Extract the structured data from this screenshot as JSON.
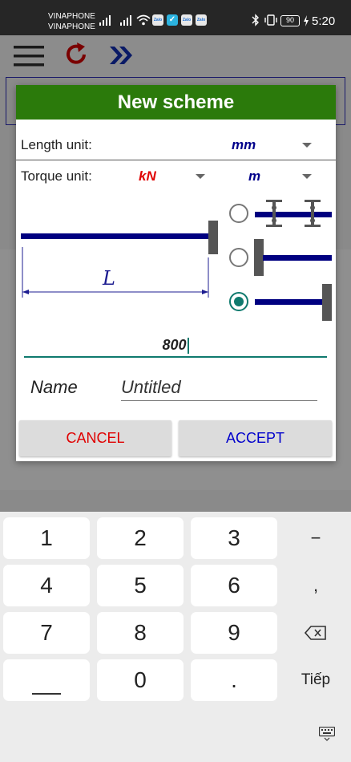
{
  "status_bar": {
    "carrier1": "VINAPHONE",
    "carrier2": "VINAPHONE",
    "battery": "90",
    "time": "5:20",
    "app_icon_label": "Zalo"
  },
  "dialog": {
    "title": "New scheme",
    "length_unit": {
      "label": "Length unit:",
      "value": "mm"
    },
    "torque_unit": {
      "label": "Torque unit:",
      "force": "kN",
      "length": "m"
    },
    "diagram_dimension_label": "L",
    "support_options": [
      {
        "name": "simply-supported",
        "selected": false
      },
      {
        "name": "fixed-left",
        "selected": false
      },
      {
        "name": "fixed-right",
        "selected": true
      }
    ],
    "length_value": "800",
    "name_label": "Name",
    "name_value": "Untitled",
    "cancel": "CANCEL",
    "accept": "ACCEPT"
  },
  "keyboard": {
    "keys": [
      "1",
      "2",
      "3",
      "4",
      "5",
      "6",
      "7",
      "8",
      "9",
      "0",
      "."
    ],
    "minus": "−",
    "comma": ",",
    "next": "Tiếp"
  },
  "colors": {
    "title_bar": "#2b7a0b",
    "beam": "#000080",
    "accent": "#0f7a6e",
    "cancel": "#e00000",
    "accept": "#0000cc",
    "torque_force": "#e00000"
  }
}
